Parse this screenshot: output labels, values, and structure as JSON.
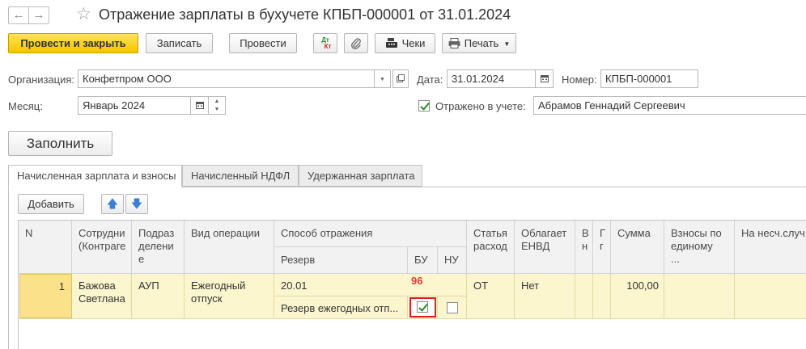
{
  "window": {
    "back_glyph": "←",
    "forward_glyph": "→",
    "star_glyph": "☆",
    "title": "Отражение зарплаты в бухучете КПБП-000001 от 31.01.2024"
  },
  "toolbar": {
    "post_close_label": "Провести и закрыть",
    "write_label": "Записать",
    "post_label": "Провести",
    "dt_label": "Дт",
    "kt_label": "Кт",
    "checks_label": "Чеки",
    "print_label": "Печать"
  },
  "form": {
    "org_label": "Организация:",
    "org_value": "Конфетпром ООО",
    "date_label": "Дата:",
    "date_value": "31.01.2024",
    "number_label": "Номер:",
    "number_value": "КПБП-000001",
    "month_label": "Месяц:",
    "month_value": "Январь 2024",
    "reflected_label": "Отражено в учете:",
    "reflected_checked": true,
    "responsible_value": "Абрамов Геннадий Сергеевич",
    "fill_label": "Заполнить"
  },
  "tabs": [
    {
      "label": "Начисленная зарплата и взносы",
      "active": true
    },
    {
      "label": "Начисленный НДФЛ",
      "active": false
    },
    {
      "label": "Удержанная зарплата",
      "active": false
    }
  ],
  "table_toolbar": {
    "add_label": "Добавить",
    "up_glyph": "🡅",
    "down_glyph": "🡇"
  },
  "table": {
    "headers": {
      "n": "N",
      "employee": "Сотрудни\n(Контраге",
      "department": "Подраз\nделени\nе",
      "operation": "Вид операции",
      "method": "Способ отражения",
      "reserve": "Резерв",
      "bu": "БУ",
      "nu": "НУ",
      "expense": "Статья\nрасход",
      "envd": "Облагает\nЕНВД",
      "col_v": "В\nн",
      "col_g": "Г\nг",
      "sum": "Сумма",
      "contrib": "Взносы по\nединому\n...",
      "accident": "На несч.случ"
    },
    "rows": [
      {
        "n": "1",
        "employee": "Бажова\nСветлана",
        "department": "АУП",
        "operation": "Ежегодный\nотпуск",
        "method": "20.01",
        "reserve": "Резерв ежегодных отп...",
        "bu_checked": true,
        "nu_checked": false,
        "expense": "ОТ",
        "envd": "Нет",
        "sum": "100,00"
      }
    ]
  },
  "annotation": {
    "marker_text": "96",
    "marker_color": "#e53935"
  },
  "colors": {
    "accent_button": "#f5c400",
    "row_selected": "#fcf6cf",
    "row_current_cell": "#fbe18a",
    "arrow_blue": "#3a7fd5",
    "check_green": "#2e8b2e"
  }
}
